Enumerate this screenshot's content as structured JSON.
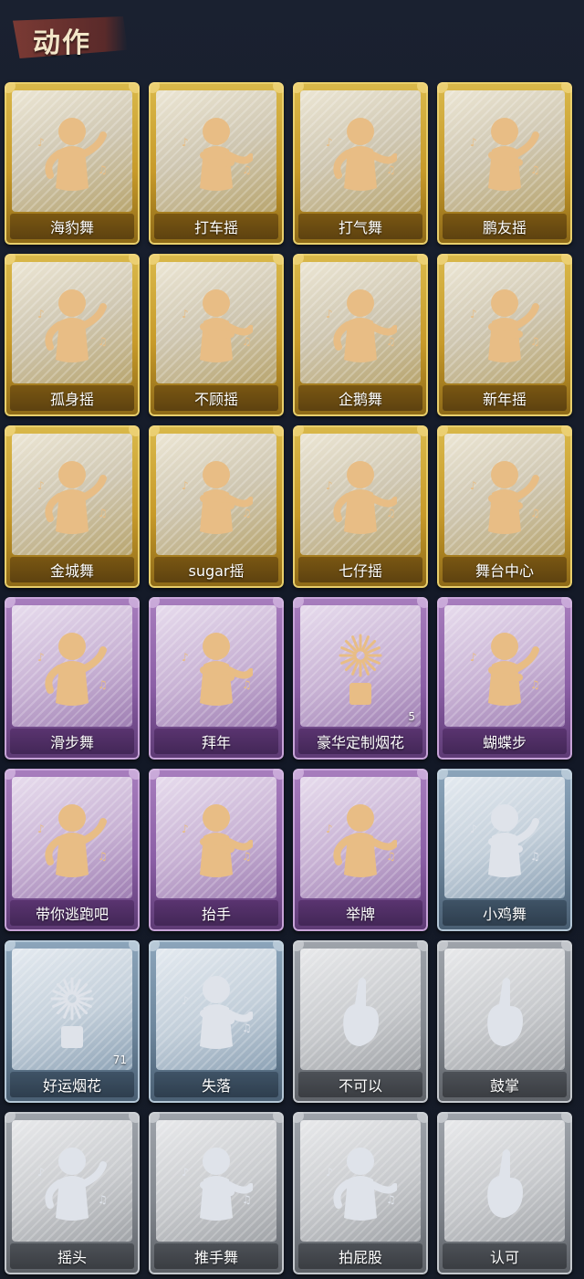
{
  "header": {
    "title": "动作"
  },
  "colors": {
    "gold": "#c79a2a",
    "purple": "#8b5fa6",
    "blue": "#6d869c",
    "gray": "#83888f",
    "figure_gold": "#e8bd85",
    "figure_silver": "#dfe3ea"
  },
  "actions": [
    {
      "label": "海豹舞",
      "tier": "gold",
      "icon": "seal-dance-figure-icon"
    },
    {
      "label": "打车摇",
      "tier": "gold",
      "icon": "taxi-sway-figure-icon"
    },
    {
      "label": "打气舞",
      "tier": "gold",
      "icon": "pump-dance-figure-icon"
    },
    {
      "label": "鹏友摇",
      "tier": "gold",
      "icon": "friend-sway-figure-icon"
    },
    {
      "label": "孤身摇",
      "tier": "gold",
      "icon": "solo-sway-figure-icon"
    },
    {
      "label": "不顾摇",
      "tier": "gold",
      "icon": "carefree-sway-figure-icon"
    },
    {
      "label": "企鹅舞",
      "tier": "gold",
      "icon": "penguin-dance-figure-icon"
    },
    {
      "label": "新年摇",
      "tier": "gold",
      "icon": "new-year-sway-figure-icon"
    },
    {
      "label": "金城舞",
      "tier": "gold",
      "icon": "jincheng-dance-figure-icon"
    },
    {
      "label": "sugar摇",
      "tier": "gold",
      "icon": "sugar-sway-figure-icon"
    },
    {
      "label": "七仔摇",
      "tier": "gold",
      "icon": "qizai-sway-figure-icon"
    },
    {
      "label": "舞台中心",
      "tier": "gold",
      "icon": "stage-center-figure-icon"
    },
    {
      "label": "滑步舞",
      "tier": "purple",
      "icon": "slide-dance-figure-icon"
    },
    {
      "label": "拜年",
      "tier": "purple",
      "icon": "new-year-greeting-figure-icon"
    },
    {
      "label": "豪华定制烟花",
      "tier": "purple",
      "icon": "deluxe-fireworks-icon",
      "count": "5"
    },
    {
      "label": "蝴蝶步",
      "tier": "purple",
      "icon": "butterfly-step-figure-icon"
    },
    {
      "label": "带你逃跑吧",
      "tier": "purple",
      "icon": "run-away-figure-icon"
    },
    {
      "label": "抬手",
      "tier": "purple",
      "icon": "raise-hand-figure-icon"
    },
    {
      "label": "举牌",
      "tier": "purple",
      "icon": "hold-sign-figure-icon"
    },
    {
      "label": "小鸡舞",
      "tier": "blue",
      "icon": "chicken-dance-figure-icon"
    },
    {
      "label": "好运烟花",
      "tier": "blue",
      "icon": "lucky-fireworks-icon",
      "count": "71"
    },
    {
      "label": "失落",
      "tier": "blue",
      "icon": "lost-crawling-figure-icon"
    },
    {
      "label": "不可以",
      "tier": "gray",
      "icon": "finger-wag-hand-icon"
    },
    {
      "label": "鼓掌",
      "tier": "gray",
      "icon": "clapping-hands-icon"
    },
    {
      "label": "摇头",
      "tier": "gray",
      "icon": "shake-head-figure-icon"
    },
    {
      "label": "推手舞",
      "tier": "gray",
      "icon": "push-hand-dance-figure-icon"
    },
    {
      "label": "拍屁股",
      "tier": "gray",
      "icon": "slap-butt-figure-icon"
    },
    {
      "label": "认可",
      "tier": "gray",
      "icon": "thumbs-up-hand-icon"
    }
  ]
}
